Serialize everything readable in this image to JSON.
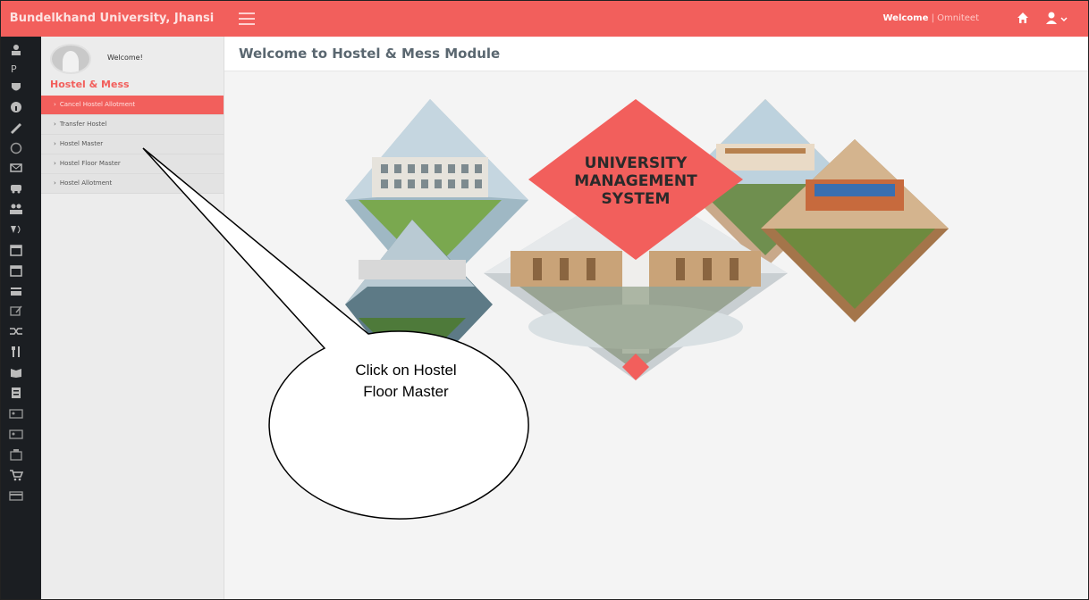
{
  "topbar": {
    "brand": "Bundelkhand University, Jhansi",
    "welcome_label": "Welcome",
    "welcome_user": " | Omniteet"
  },
  "sidebar": {
    "welcome": "Welcome!",
    "title": "Hostel & Mess",
    "items": [
      {
        "label": "Cancel Hostel Allotment",
        "active": true
      },
      {
        "label": "Transfer Hostel",
        "active": false
      },
      {
        "label": "Hostel Master",
        "active": false
      },
      {
        "label": "Hostel Floor Master",
        "active": false
      },
      {
        "label": "Hostel Allotment",
        "active": false
      }
    ]
  },
  "main": {
    "title": "Welcome to Hostel & Mess Module"
  },
  "banner": {
    "line1": "UNIVERSITY",
    "line2": "MANAGEMENT",
    "line3": "SYSTEM"
  },
  "callout": {
    "line1": "Click on Hostel",
    "line2": "Floor Master"
  },
  "colors": {
    "accent": "#f25f5c",
    "rail": "#1b1e22"
  }
}
